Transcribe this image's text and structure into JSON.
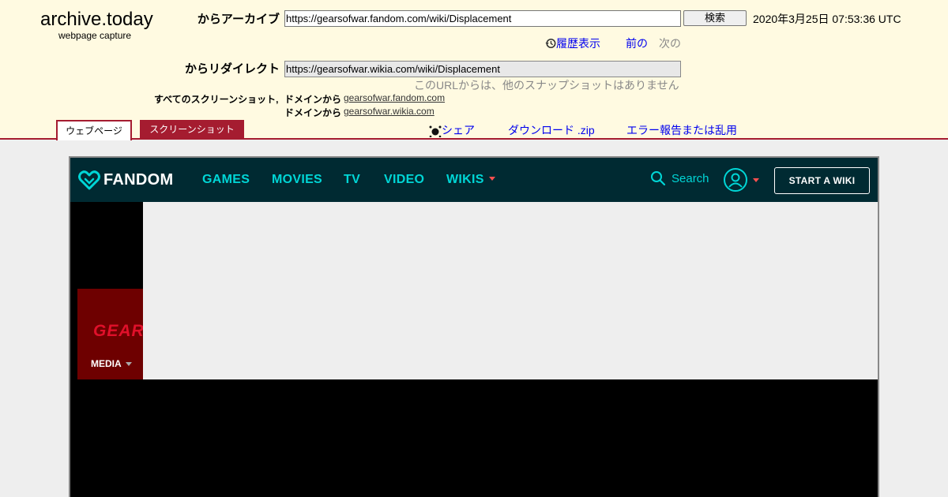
{
  "archive": {
    "logo_title": "archive.today",
    "logo_subtitle": "webpage capture",
    "from_archive_label": "からアーカイブ",
    "archived_url": "https://gearsofwar.fandom.com/wiki/Displacement",
    "search_button": "検索",
    "timestamp": "2020年3月25日 07:53:36 UTC",
    "history_link": "履歴表示",
    "prev_link": "前の",
    "next_link": "次の",
    "redirect_label": "からリダイレクト",
    "redirect_url": "https://gearsofwar.wikia.com/wiki/Displacement",
    "no_other_snapshots": "このURLからは、他のスナップショットはありません",
    "all_screenshots_label": "すべてのスクリーンショット,",
    "domain_label_1": "ドメインから",
    "domain_link_1": "gearsofwar.fandom.com",
    "domain_label_2": "ドメインから",
    "domain_link_2": "gearsofwar.wikia.com",
    "tab_webpage": "ウェブページ",
    "tab_screenshot": "スクリーンショット",
    "share_link": "シェア",
    "download_link": "ダウンロード .zip",
    "report_link": "エラー報告または乱用",
    "accent_color": "#a51c30",
    "background_color": "#fffae1"
  },
  "fandom": {
    "logo_text": "FANDOM",
    "nav": {
      "games": "GAMES",
      "movies": "MOVIES",
      "tv": "TV",
      "video": "VIDEO",
      "wikis": "WIKIS"
    },
    "search_label": "Search",
    "start_wiki_button": "START A WIKI",
    "nav_color": "#00d6d6",
    "bar_color": "#002a32"
  },
  "wiki": {
    "logo_text": "GEARS",
    "media_menu": "MEDIA",
    "header_color": "#6e0000"
  }
}
